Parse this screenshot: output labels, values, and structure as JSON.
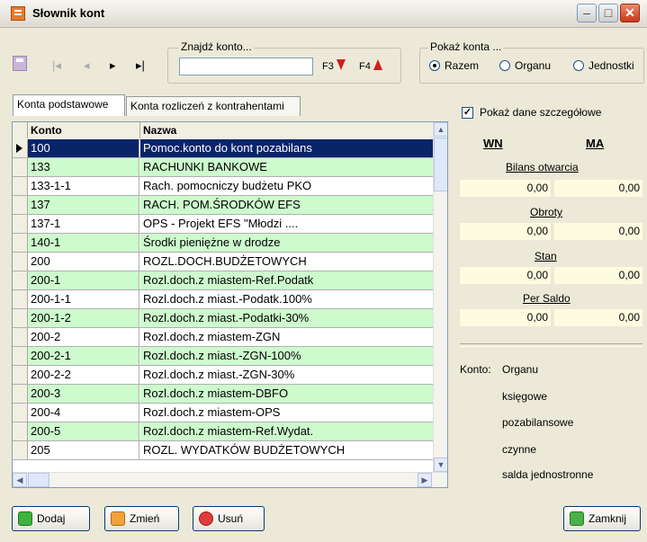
{
  "window": {
    "title": "Słownik kont"
  },
  "search": {
    "label": "Znajdź konto...",
    "value": "",
    "f3": "F3",
    "f4": "F4"
  },
  "show_accounts": {
    "label": "Pokaż konta ...",
    "options": [
      "Razem",
      "Organu",
      "Jednostki"
    ],
    "selected": "Razem"
  },
  "tabs": [
    "Konta podstawowe",
    "Konta rozliczeń z kontrahentami"
  ],
  "grid": {
    "headers": [
      "Konto",
      "Nazwa"
    ],
    "rows": [
      [
        "100",
        "Pomoc.konto do kont pozabilans"
      ],
      [
        "133",
        "RACHUNKI BANKOWE"
      ],
      [
        "133-1-1",
        "Rach. pomocniczy budżetu PKO"
      ],
      [
        "137",
        "RACH. POM.ŚRODKÓW  EFS"
      ],
      [
        "137-1",
        "OPS - Projekt EFS \"Młodzi ...."
      ],
      [
        "140-1",
        "Środki pieniężne w drodze"
      ],
      [
        "200",
        "ROZL.DOCH.BUDŻETOWYCH"
      ],
      [
        "200-1",
        "Rozl.doch.z miastem-Ref.Podatk"
      ],
      [
        "200-1-1",
        "Rozl.doch.z miast.-Podatk.100%"
      ],
      [
        "200-1-2",
        "Rozl.doch.z miast.-Podatki-30%"
      ],
      [
        "200-2",
        "Rozl.doch.z miastem-ZGN"
      ],
      [
        "200-2-1",
        "Rozl.doch.z miast.-ZGN-100%"
      ],
      [
        "200-2-2",
        "Rozl.doch.z miast.-ZGN-30%"
      ],
      [
        "200-3",
        "Rozl.doch.z miastem-DBFO"
      ],
      [
        "200-4",
        "Rozl.doch.z miastem-OPS"
      ],
      [
        "200-5",
        "Rozl.doch.z miastem-Ref.Wydat."
      ],
      [
        "205",
        "ROZL. WYDATKÓW BUDŻETOWYCH"
      ]
    ]
  },
  "details": {
    "show_label": "Pokaż dane szczegółowe",
    "wn": "WN",
    "ma": "MA",
    "sections": [
      {
        "label": "Bilans otwarcia",
        "wn": "0,00",
        "ma": "0,00"
      },
      {
        "label": "Obroty",
        "wn": "0,00",
        "ma": "0,00"
      },
      {
        "label": "Stan",
        "wn": "0,00",
        "ma": "0,00"
      },
      {
        "label": "Per Saldo",
        "wn": "0,00",
        "ma": "0,00"
      }
    ],
    "konto_label": "Konto:",
    "konto_info": [
      "Organu",
      "księgowe",
      "pozabilansowe",
      "czynne",
      "salda jednostronne"
    ]
  },
  "buttons": {
    "add": "Dodaj",
    "edit": "Zmień",
    "delete": "Usuń",
    "close": "Zamknij"
  },
  "colors": {
    "even_row": "#cdfbcd",
    "selected_row": "#0a246a",
    "value_bg": "#fdfbe0"
  }
}
